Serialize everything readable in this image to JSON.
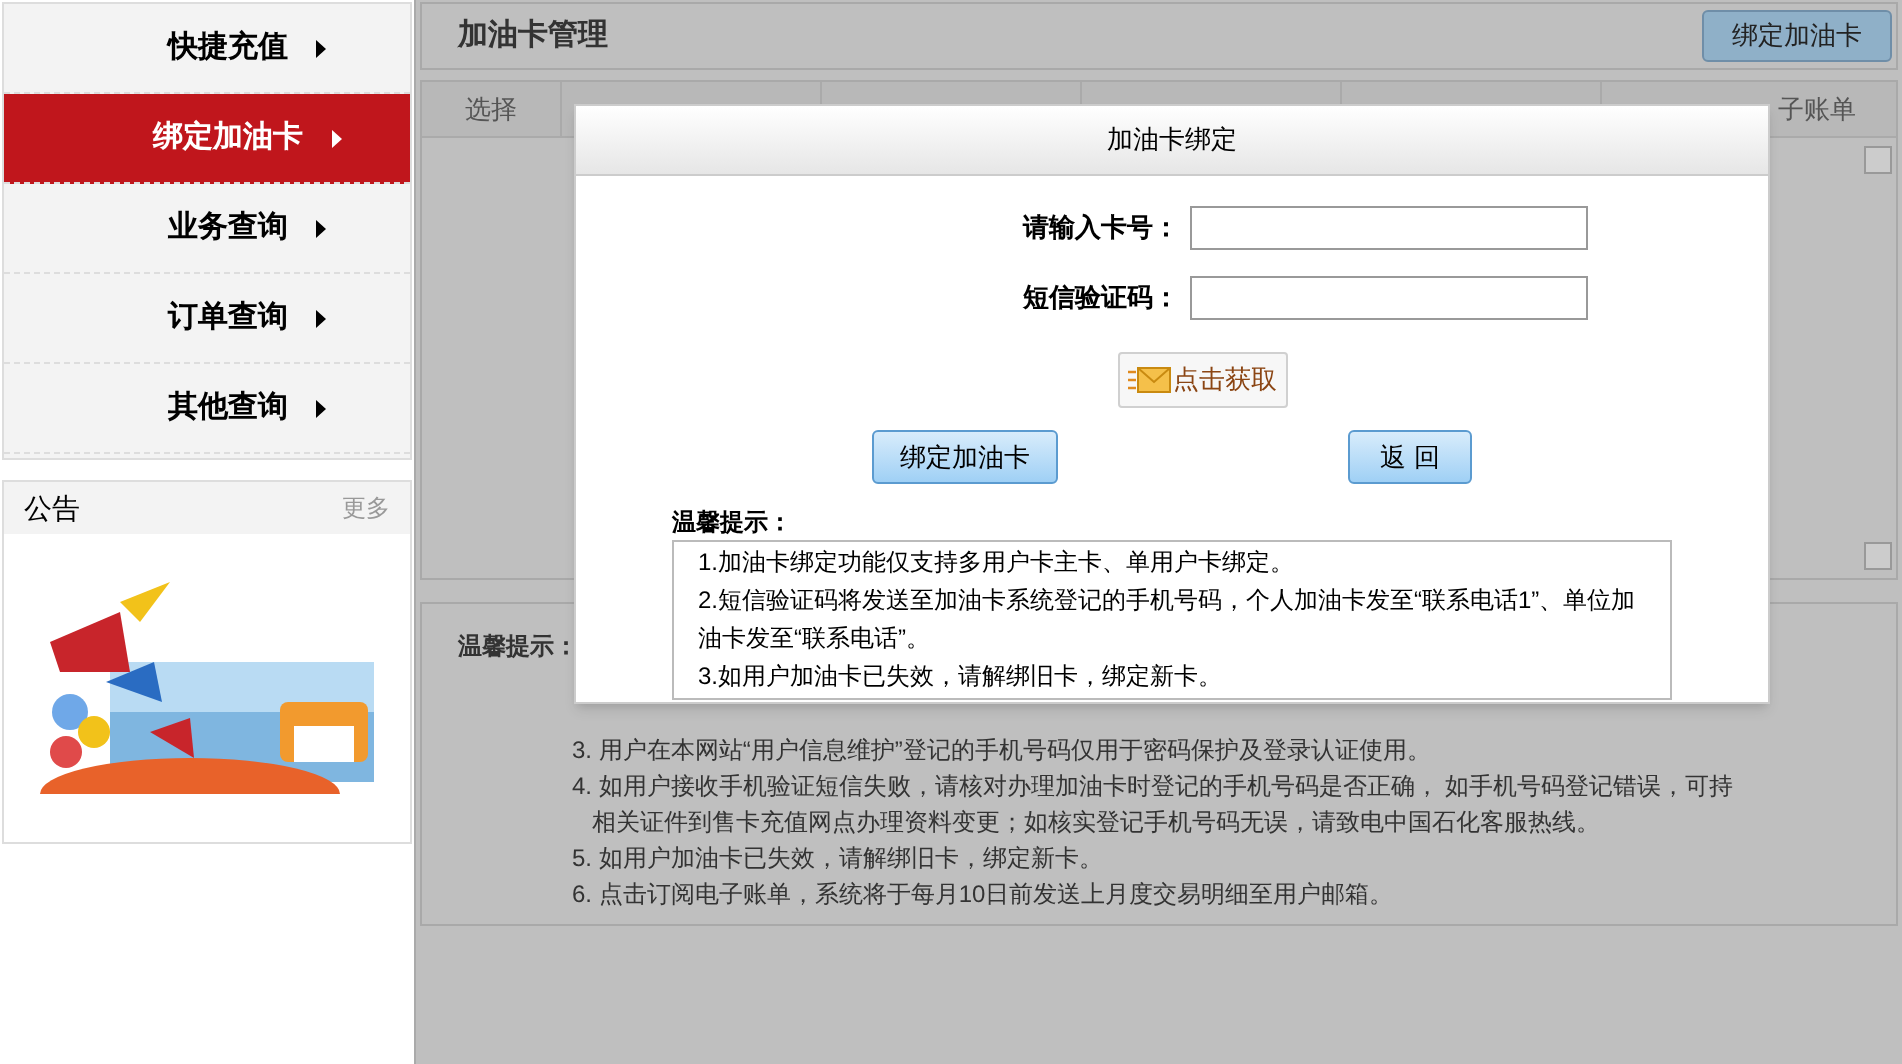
{
  "sidebar": {
    "items": [
      {
        "label": "快捷充值",
        "selected": false
      },
      {
        "label": "绑定加油卡",
        "selected": true
      },
      {
        "label": "业务查询",
        "selected": false
      },
      {
        "label": "订单查询",
        "selected": false
      },
      {
        "label": "其他查询",
        "selected": false
      }
    ]
  },
  "notice": {
    "title": "公告",
    "more": "更多"
  },
  "main": {
    "title": "加油卡管理",
    "bind_button": "绑定加油卡",
    "table": {
      "columns": [
        {
          "label": "选择"
        },
        {
          "label": "子账单"
        }
      ]
    },
    "tips": {
      "title": "温馨提示：",
      "items": [
        {
          "text": "3. 用户在本网站“用户信息维护”登记的手机号码仅用于密码保护及登录认证使用。"
        },
        {
          "text": "4. 如用户接收手机验证短信失败，请核对办理加油卡时登记的手机号码是否正确， 如手机号码登记错误，可持相关证件到售卡充值网点办理资料变更；如核实登记手机号码无误，请致电中国石化客服热线。"
        },
        {
          "text": "5. 如用户加油卡已失效，请解绑旧卡，绑定新卡。"
        },
        {
          "text": "6. 点击订阅电子账单，系统将于每月10日前发送上月度交易明细至用户邮箱。"
        }
      ]
    }
  },
  "dialog": {
    "title": "加油卡绑定",
    "fields": [
      {
        "label": "请输入卡号："
      },
      {
        "label": "短信验证码："
      }
    ],
    "sms_button": "点击获取",
    "bind_button": "绑定加油卡",
    "back_button": "返 回",
    "tips_title": "温馨提示：",
    "tips": [
      "1.加油卡绑定功能仅支持多用户卡主卡、单用户卡绑定。",
      "2.短信验证码将发送至加油卡系统登记的手机号码，个人加油卡发至“联系电话1”、单位加油卡发至“联系电话”。",
      "3.如用户加油卡已失效，请解绑旧卡，绑定新卡。"
    ]
  }
}
